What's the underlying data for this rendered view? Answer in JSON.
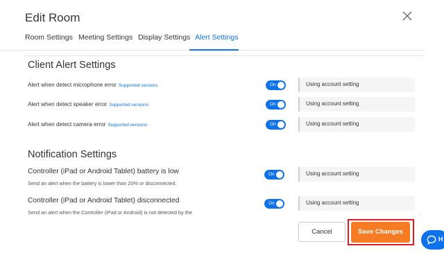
{
  "dialog": {
    "title": "Edit Room",
    "close_icon": "close-icon"
  },
  "tabs": [
    {
      "label": "Room Settings",
      "active": false
    },
    {
      "label": "Meeting Settings",
      "active": false
    },
    {
      "label": "Display Settings",
      "active": false
    },
    {
      "label": "Alert Settings",
      "active": true
    }
  ],
  "client_alerts": {
    "title": "Client Alert Settings",
    "rows": [
      {
        "label": "Alert when detect microphone error",
        "link": "Supported versions",
        "toggle": "On",
        "account_setting": "Using account setting"
      },
      {
        "label": "Alert when detect speaker error",
        "link": "Supported versions",
        "toggle": "On",
        "account_setting": "Using account setting"
      },
      {
        "label": "Alert when detect camera error",
        "link": "Supported versions",
        "toggle": "On",
        "account_setting": "Using account setting"
      }
    ]
  },
  "notifications": {
    "title": "Notification Settings",
    "rows": [
      {
        "label": "Controller (iPad or Android Tablet) battery is low",
        "description": "Send an alert when the battery is lower than 20% or disconnected.",
        "toggle": "On",
        "account_setting": "Using account setting"
      },
      {
        "label": "Controller (iPad or Android Tablet) disconnected",
        "description": "Send an alert when the Controller (iPad or Android) is not detected by the",
        "toggle": "On",
        "account_setting": "Using account setting"
      }
    ]
  },
  "footer": {
    "cancel_label": "Cancel",
    "save_label": "Save Changes"
  },
  "help_widget": {
    "label": "H",
    "icon": "chat-bubble-icon"
  },
  "colors": {
    "accent": "#0e72ed",
    "save": "#f77b23",
    "highlight": "#e3191d"
  }
}
